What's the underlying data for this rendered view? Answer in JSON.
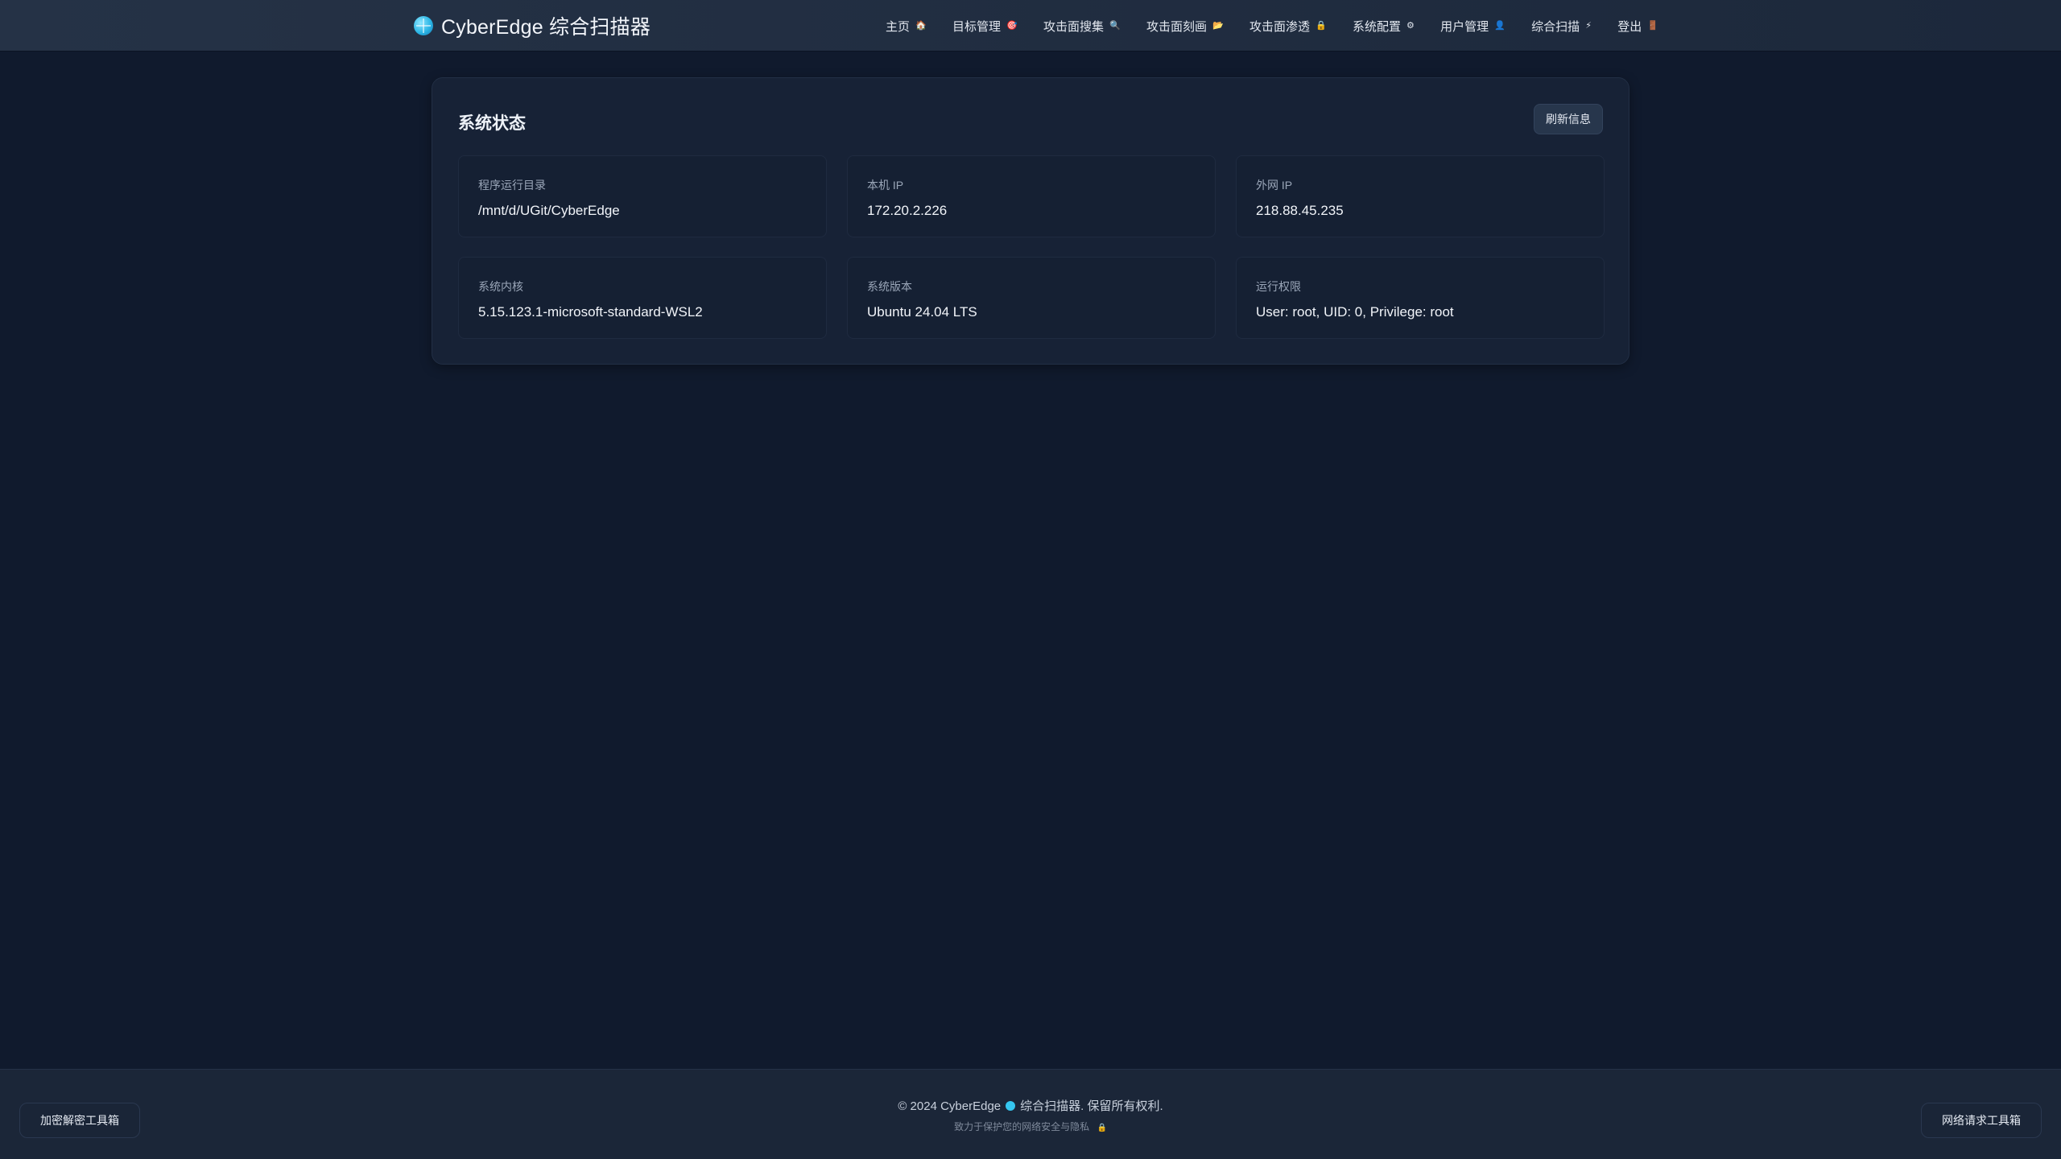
{
  "brand": {
    "title": "CyberEdge 综合扫描器",
    "logo_icon": "globe-icon",
    "logo_color": "#2bb6e6"
  },
  "nav": {
    "items": [
      {
        "label": "主页",
        "icon": "🏠",
        "icon_name": "home-icon"
      },
      {
        "label": "目标管理",
        "icon": "🎯",
        "icon_name": "target-icon"
      },
      {
        "label": "攻击面搜集",
        "icon": "🔍",
        "icon_name": "search-icon"
      },
      {
        "label": "攻击面刻画",
        "icon": "📂",
        "icon_name": "folder-icon"
      },
      {
        "label": "攻击面渗透",
        "icon": "🔒",
        "icon_name": "lock-icon"
      },
      {
        "label": "系统配置",
        "icon": "⚙",
        "icon_name": "gear-icon"
      },
      {
        "label": "用户管理",
        "icon": "👤",
        "icon_name": "user-icon"
      },
      {
        "label": "综合扫描",
        "icon": "⚡",
        "icon_name": "lightning-icon"
      },
      {
        "label": "登出",
        "icon": "🚪",
        "icon_name": "door-icon"
      }
    ]
  },
  "status": {
    "title": "系统状态",
    "refresh_label": "刷新信息",
    "cards": [
      {
        "label": "程序运行目录",
        "value": "/mnt/d/UGit/CyberEdge"
      },
      {
        "label": "本机 IP",
        "value": "172.20.2.226"
      },
      {
        "label": "外网 IP",
        "value": "218.88.45.235"
      },
      {
        "label": "系统内核",
        "value": "5.15.123.1-microsoft-standard-WSL2"
      },
      {
        "label": "系统版本",
        "value": "Ubuntu 24.04 LTS"
      },
      {
        "label": "运行权限",
        "value": "User: root, UID: 0, Privilege: root"
      }
    ]
  },
  "footer": {
    "copyright_prefix": "© 2024 CyberEdge",
    "copyright_suffix": "综合扫描器. 保留所有权利.",
    "tagline": "致力于保护您的网络安全与隐私",
    "tagline_icon": "🔒",
    "left_tool": "加密解密工具箱",
    "right_tool": "网络请求工具箱"
  },
  "colors": {
    "background": "#101a2d",
    "card": "#172236",
    "accent": "#35c6f0"
  }
}
